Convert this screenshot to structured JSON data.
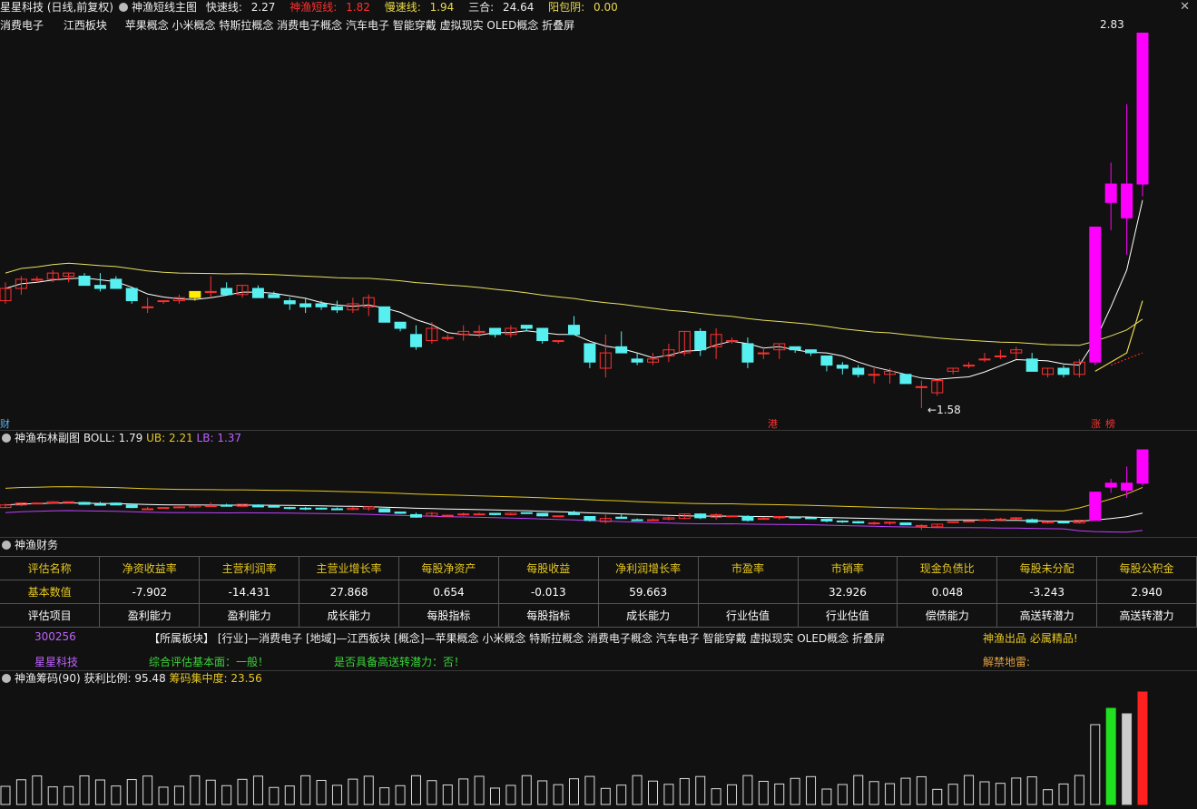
{
  "header": {
    "stock": "星星科技 (日线,前复权)",
    "indicator": "神渔短线主图",
    "fast_label": "快速线:",
    "fast_value": "2.27",
    "short_label": "神渔短线:",
    "short_value": "1.82",
    "slow_label": "慢速线:",
    "slow_value": "1.94",
    "sanhe_label": "三合:",
    "sanhe_value": "24.64",
    "yang_label": "阳包阴:",
    "yang_value": "0.00"
  },
  "sector_line": {
    "industry": "消费电子",
    "region": "江西板块",
    "concepts": "苹果概念 小米概念 特斯拉概念 消费电子概念 汽车电子 智能穿戴 虚拟现实 OLED概念 折叠屏"
  },
  "main_chart": {
    "high_label": "2.83",
    "low_label": "1.58",
    "marker_left": "财",
    "marker_gang": "港",
    "marker_zhang": "涨",
    "marker_bang": "榜"
  },
  "boll_header": {
    "title": "神渔布林副图",
    "boll_label": "BOLL:",
    "boll_value": "1.79",
    "ub_label": "UB:",
    "ub_value": "2.21",
    "lb_label": "LB:",
    "lb_value": "1.37"
  },
  "finance_header": {
    "title": "神渔财务"
  },
  "finance_table": {
    "headers": [
      "评估名称",
      "净资收益率",
      "主营利润率",
      "主营业增长率",
      "每股净资产",
      "每股收益",
      "净利润增长率",
      "市盈率",
      "市销率",
      "现金负债比",
      "每股未分配",
      "每股公积金"
    ],
    "values": [
      "基本数值",
      "-7.902",
      "-14.431",
      "27.868",
      "0.654",
      "-0.013",
      "59.663",
      "",
      "32.926",
      "0.048",
      "-3.243",
      "2.940"
    ],
    "categories": [
      "评估项目",
      "盈利能力",
      "盈利能力",
      "成长能力",
      "每股指标",
      "每股指标",
      "成长能力",
      "行业估值",
      "行业估值",
      "偿债能力",
      "高送转潜力",
      "高送转潜力"
    ]
  },
  "info": {
    "code": "300256",
    "name": "星星科技",
    "sector_text": "【所属板块】 [行业]—消费电子 [地域]—江西板块 [概念]—苹果概念 小米概念 特斯拉概念 消费电子概念 汽车电子 智能穿戴 虚拟现实 OLED概念 折叠屏",
    "eval_text": "综合评估基本面：一般！",
    "transfer_text": "是否具备高送转潜力：否！",
    "brand_text": "神渔出品 必属精品!",
    "unlock_text": "解禁地雷:"
  },
  "chip_header": {
    "title": "神渔筹码(90)",
    "profit_label": "获利比例:",
    "profit_value": "95.48",
    "conc_label": "筹码集中度:",
    "conc_value": "23.56"
  },
  "window_controls": {
    "close": "✕"
  },
  "colors": {
    "up": "#ff3030",
    "down": "#56f0f0",
    "limit": "#ff00ff",
    "ma_slow": "#e8e060",
    "ma_fast": "#ffffff"
  },
  "chart_data": {
    "type": "candlestick",
    "title": "星星科技 (日线,前复权)",
    "price_range": [
      1.5,
      2.9
    ],
    "candles": [
      {
        "o": 1.93,
        "h": 1.99,
        "l": 1.92,
        "c": 1.97
      },
      {
        "o": 1.97,
        "h": 2.01,
        "l": 1.95,
        "c": 2.0
      },
      {
        "o": 2.0,
        "h": 2.01,
        "l": 1.99,
        "c": 2.0
      },
      {
        "o": 2.0,
        "h": 2.03,
        "l": 1.99,
        "c": 2.02
      },
      {
        "o": 2.01,
        "h": 2.02,
        "l": 1.99,
        "c": 2.02
      },
      {
        "o": 2.01,
        "h": 2.02,
        "l": 1.99,
        "c": 1.98
      },
      {
        "o": 1.98,
        "h": 2.02,
        "l": 1.96,
        "c": 1.97
      },
      {
        "o": 2.0,
        "h": 2.01,
        "l": 1.97,
        "c": 1.97
      },
      {
        "o": 1.97,
        "h": 1.96,
        "l": 1.92,
        "c": 1.93
      },
      {
        "o": 1.91,
        "h": 1.94,
        "l": 1.89,
        "c": 1.91
      },
      {
        "o": 1.93,
        "h": 1.93,
        "l": 1.92,
        "c": 1.93
      },
      {
        "o": 1.93,
        "h": 1.95,
        "l": 1.92,
        "c": 1.94
      },
      {
        "o": 1.94,
        "h": 1.96,
        "l": 1.93,
        "c": 1.96
      },
      {
        "o": 1.96,
        "h": 2.01,
        "l": 1.94,
        "c": 1.96
      },
      {
        "o": 1.97,
        "h": 1.99,
        "l": 1.95,
        "c": 1.95
      },
      {
        "o": 1.95,
        "h": 1.98,
        "l": 1.94,
        "c": 1.98
      },
      {
        "o": 1.97,
        "h": 1.98,
        "l": 1.94,
        "c": 1.94
      },
      {
        "o": 1.95,
        "h": 1.96,
        "l": 1.94,
        "c": 1.94
      },
      {
        "o": 1.93,
        "h": 1.94,
        "l": 1.9,
        "c": 1.92
      },
      {
        "o": 1.92,
        "h": 1.94,
        "l": 1.89,
        "c": 1.91
      },
      {
        "o": 1.92,
        "h": 1.93,
        "l": 1.9,
        "c": 1.91
      },
      {
        "o": 1.91,
        "h": 1.93,
        "l": 1.89,
        "c": 1.9
      },
      {
        "o": 1.9,
        "h": 1.94,
        "l": 1.89,
        "c": 1.92
      },
      {
        "o": 1.91,
        "h": 1.95,
        "l": 1.88,
        "c": 1.94
      },
      {
        "o": 1.91,
        "h": 1.9,
        "l": 1.86,
        "c": 1.86
      },
      {
        "o": 1.86,
        "h": 1.86,
        "l": 1.83,
        "c": 1.84
      },
      {
        "o": 1.82,
        "h": 1.85,
        "l": 1.77,
        "c": 1.78
      },
      {
        "o": 1.8,
        "h": 1.86,
        "l": 1.79,
        "c": 1.84
      },
      {
        "o": 1.81,
        "h": 1.82,
        "l": 1.8,
        "c": 1.81
      },
      {
        "o": 1.82,
        "h": 1.85,
        "l": 1.8,
        "c": 1.83
      },
      {
        "o": 1.83,
        "h": 1.85,
        "l": 1.81,
        "c": 1.83
      },
      {
        "o": 1.84,
        "h": 1.84,
        "l": 1.81,
        "c": 1.82
      },
      {
        "o": 1.82,
        "h": 1.85,
        "l": 1.81,
        "c": 1.84
      },
      {
        "o": 1.85,
        "h": 1.85,
        "l": 1.83,
        "c": 1.84
      },
      {
        "o": 1.84,
        "h": 1.83,
        "l": 1.79,
        "c": 1.8
      },
      {
        "o": 1.8,
        "h": 1.8,
        "l": 1.79,
        "c": 1.8
      },
      {
        "o": 1.85,
        "h": 1.88,
        "l": 1.82,
        "c": 1.82
      },
      {
        "o": 1.79,
        "h": 1.79,
        "l": 1.71,
        "c": 1.73
      },
      {
        "o": 1.71,
        "h": 1.82,
        "l": 1.68,
        "c": 1.76
      },
      {
        "o": 1.78,
        "h": 1.83,
        "l": 1.76,
        "c": 1.76
      },
      {
        "o": 1.74,
        "h": 1.76,
        "l": 1.72,
        "c": 1.73
      },
      {
        "o": 1.73,
        "h": 1.76,
        "l": 1.72,
        "c": 1.74
      },
      {
        "o": 1.75,
        "h": 1.79,
        "l": 1.73,
        "c": 1.77
      },
      {
        "o": 1.76,
        "h": 1.83,
        "l": 1.75,
        "c": 1.83
      },
      {
        "o": 1.83,
        "h": 1.84,
        "l": 1.75,
        "c": 1.77
      },
      {
        "o": 1.78,
        "h": 1.84,
        "l": 1.74,
        "c": 1.82
      },
      {
        "o": 1.8,
        "h": 1.81,
        "l": 1.79,
        "c": 1.8
      },
      {
        "o": 1.79,
        "h": 1.81,
        "l": 1.71,
        "c": 1.73
      },
      {
        "o": 1.76,
        "h": 1.78,
        "l": 1.74,
        "c": 1.76
      },
      {
        "o": 1.77,
        "h": 1.79,
        "l": 1.74,
        "c": 1.79
      },
      {
        "o": 1.78,
        "h": 1.78,
        "l": 1.76,
        "c": 1.77
      },
      {
        "o": 1.77,
        "h": 1.77,
        "l": 1.75,
        "c": 1.76
      },
      {
        "o": 1.75,
        "h": 1.75,
        "l": 1.7,
        "c": 1.72
      },
      {
        "o": 1.72,
        "h": 1.73,
        "l": 1.69,
        "c": 1.71
      },
      {
        "o": 1.71,
        "h": 1.72,
        "l": 1.68,
        "c": 1.69
      },
      {
        "o": 1.69,
        "h": 1.71,
        "l": 1.66,
        "c": 1.69
      },
      {
        "o": 1.69,
        "h": 1.71,
        "l": 1.66,
        "c": 1.7
      },
      {
        "o": 1.69,
        "h": 1.69,
        "l": 1.66,
        "c": 1.66
      },
      {
        "o": 1.65,
        "h": 1.67,
        "l": 1.58,
        "c": 1.65
      },
      {
        "o": 1.63,
        "h": 1.67,
        "l": 1.62,
        "c": 1.67
      },
      {
        "o": 1.7,
        "h": 1.71,
        "l": 1.69,
        "c": 1.71
      },
      {
        "o": 1.72,
        "h": 1.73,
        "l": 1.71,
        "c": 1.72
      },
      {
        "o": 1.74,
        "h": 1.76,
        "l": 1.73,
        "c": 1.74
      },
      {
        "o": 1.75,
        "h": 1.77,
        "l": 1.74,
        "c": 1.75
      },
      {
        "o": 1.76,
        "h": 1.78,
        "l": 1.74,
        "c": 1.77
      },
      {
        "o": 1.74,
        "h": 1.76,
        "l": 1.7,
        "c": 1.7
      },
      {
        "o": 1.69,
        "h": 1.71,
        "l": 1.68,
        "c": 1.71
      },
      {
        "o": 1.71,
        "h": 1.72,
        "l": 1.68,
        "c": 1.69
      },
      {
        "o": 1.69,
        "h": 1.74,
        "l": 1.68,
        "c": 1.73
      },
      {
        "o": 1.73,
        "h": 2.17,
        "l": 1.72,
        "c": 2.17
      },
      {
        "o": 2.31,
        "h": 2.38,
        "l": 2.16,
        "c": 2.25
      },
      {
        "o": 2.2,
        "h": 2.57,
        "l": 2.08,
        "c": 2.31
      },
      {
        "o": 2.31,
        "h": 2.83,
        "l": 2.27,
        "c": 2.83
      }
    ]
  }
}
